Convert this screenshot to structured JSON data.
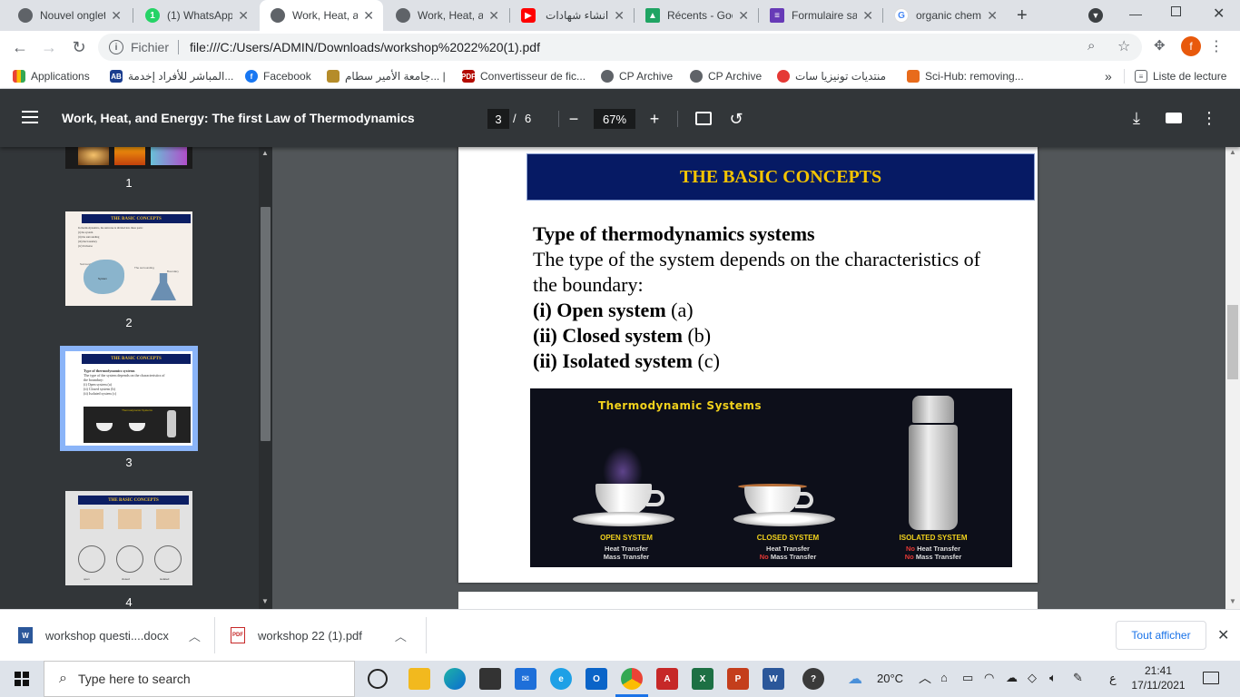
{
  "tabs": [
    {
      "title": "Nouvel onglet",
      "icon": "chrome-icon",
      "color": "#5f6368"
    },
    {
      "title": "(1) WhatsApp",
      "icon": "whatsapp-icon",
      "color": "#25d366"
    },
    {
      "title": "Work, Heat, and",
      "icon": "chrome-icon",
      "color": "#5f6368"
    },
    {
      "title": "Work, Heat, and",
      "icon": "chrome-icon",
      "color": "#5f6368"
    },
    {
      "title": "انشاء شهادات",
      "icon": "youtube-icon",
      "color": "#ff0000"
    },
    {
      "title": "Récents - Google",
      "icon": "drive-icon",
      "color": "#1fa463"
    },
    {
      "title": "Formulaire sans",
      "icon": "forms-icon",
      "color": "#673ab7"
    },
    {
      "title": "organic chemistry",
      "icon": "google-icon",
      "color": "#4285f4"
    }
  ],
  "address": {
    "scheme": "Fichier",
    "url": "file:///C:/Users/ADMIN/Downloads/workshop%2022%20(1).pdf"
  },
  "profile_initial": "f",
  "bookmarks": [
    {
      "label": "Applications"
    },
    {
      "label": "المباشر للأفراد إخدمة..."
    },
    {
      "label": "Facebook"
    },
    {
      "label": "جامعة الأمير سطام... |"
    },
    {
      "label": "Convertisseur de fic..."
    },
    {
      "label": "CP Archive"
    },
    {
      "label": "CP Archive"
    },
    {
      "label": "منتديات تونيزيا سات"
    },
    {
      "label": "Sci-Hub: removing..."
    }
  ],
  "reading_list": "Liste de lecture",
  "bookmarks_more": "»",
  "pdf": {
    "title": "Work, Heat, and Energy: The first Law of Thermodynamics",
    "current_page": "3",
    "page_sep": "/",
    "total_pages": "6",
    "zoom": "67%",
    "thumbnail_numbers": [
      "1",
      "2",
      "3",
      "4"
    ],
    "thumbs": {
      "banner": "THE BASIC CONCEPTS",
      "t2_intro": "In thermodynamics, the universe is divided into three parts:",
      "t2_items": [
        "(i) the system",
        "(ii) the surrounding",
        "(iii) the boundary",
        "(iv) Universe"
      ],
      "t2_labels": {
        "surroundings": "Surroundings",
        "system": "System",
        "surrounding": "The surrounding",
        "boundary": "Boundary"
      },
      "t3_lines": [
        "Type of thermodynamics systems",
        "The type of the system depends on the characteristics of",
        "the boundary:",
        "(i) Open system (a)",
        "(ii) Closed system (b)",
        "(ii) Isolated system (c)"
      ],
      "t3_image_title": "Thermodynamic Systems",
      "t4_labels": [
        "open",
        "closed",
        "isolated"
      ]
    },
    "slide": {
      "banner": "THE BASIC CONCEPTS",
      "heading": "Type of thermodynamics systems",
      "body1": "The type of the system depends on the characteristics of",
      "body2": "the boundary:",
      "item1_b": "(i) Open system",
      "item1_r": " (a)",
      "item2_b": "(ii) Closed system",
      "item2_r": " (b)",
      "item3_b": "(ii) Isolated system",
      "item3_r": " (c)",
      "figure": {
        "title": "Thermodynamic Systems",
        "open": {
          "name": "OPEN SYSTEM",
          "l1": "Heat Transfer",
          "l2": "Mass Transfer"
        },
        "closed": {
          "name": "CLOSED SYSTEM",
          "l1": "Heat Transfer",
          "l2_no": "No",
          "l2": " Mass Transfer"
        },
        "isolated": {
          "name": "ISOLATED SYSTEM",
          "l1_no": "No",
          "l1": " Heat Transfer",
          "l2_no": "No",
          "l2": " Mass Transfer"
        }
      }
    }
  },
  "downloads": [
    {
      "name": "workshop questi....docx",
      "type": "W"
    },
    {
      "name": "workshop 22 (1).pdf",
      "type": "PDF"
    }
  ],
  "downloads_show_all": "Tout afficher",
  "taskbar": {
    "search_placeholder": "Type here to search",
    "temperature": "20°C",
    "lang": "ع",
    "time": "21:41",
    "date": "17/11/2021"
  },
  "colors": {
    "accent": "#1a73e8",
    "slide_banner": "#061a64",
    "slide_banner_text": "#f4c400",
    "pdf_toolbar": "#323639"
  }
}
